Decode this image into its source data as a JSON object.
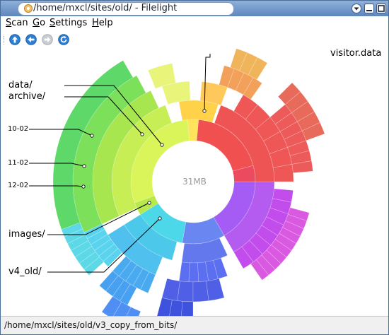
{
  "window": {
    "title": "/home/mxcl/sites/old/ - Filelight"
  },
  "menu": {
    "items": [
      {
        "key": "S",
        "rest": "can"
      },
      {
        "key": "G",
        "rest": "o"
      },
      {
        "key": "S",
        "rest": "ettings"
      },
      {
        "key": "H",
        "rest": "elp"
      }
    ]
  },
  "toolbar": {
    "icons": [
      "up-icon",
      "back-icon",
      "forward-icon",
      "refresh-icon"
    ]
  },
  "map": {
    "center_label": "31MB",
    "labels": {
      "visitor": "visitor.data",
      "data": "data/",
      "archive": "archive/",
      "l1002": "10-02",
      "l1102": "11-02",
      "l1202": "12-02",
      "images": "images/",
      "v4old": "v4_old/"
    }
  },
  "status": {
    "path": "/home/mxcl/sites/old/v3_copy_from_bits/"
  }
}
